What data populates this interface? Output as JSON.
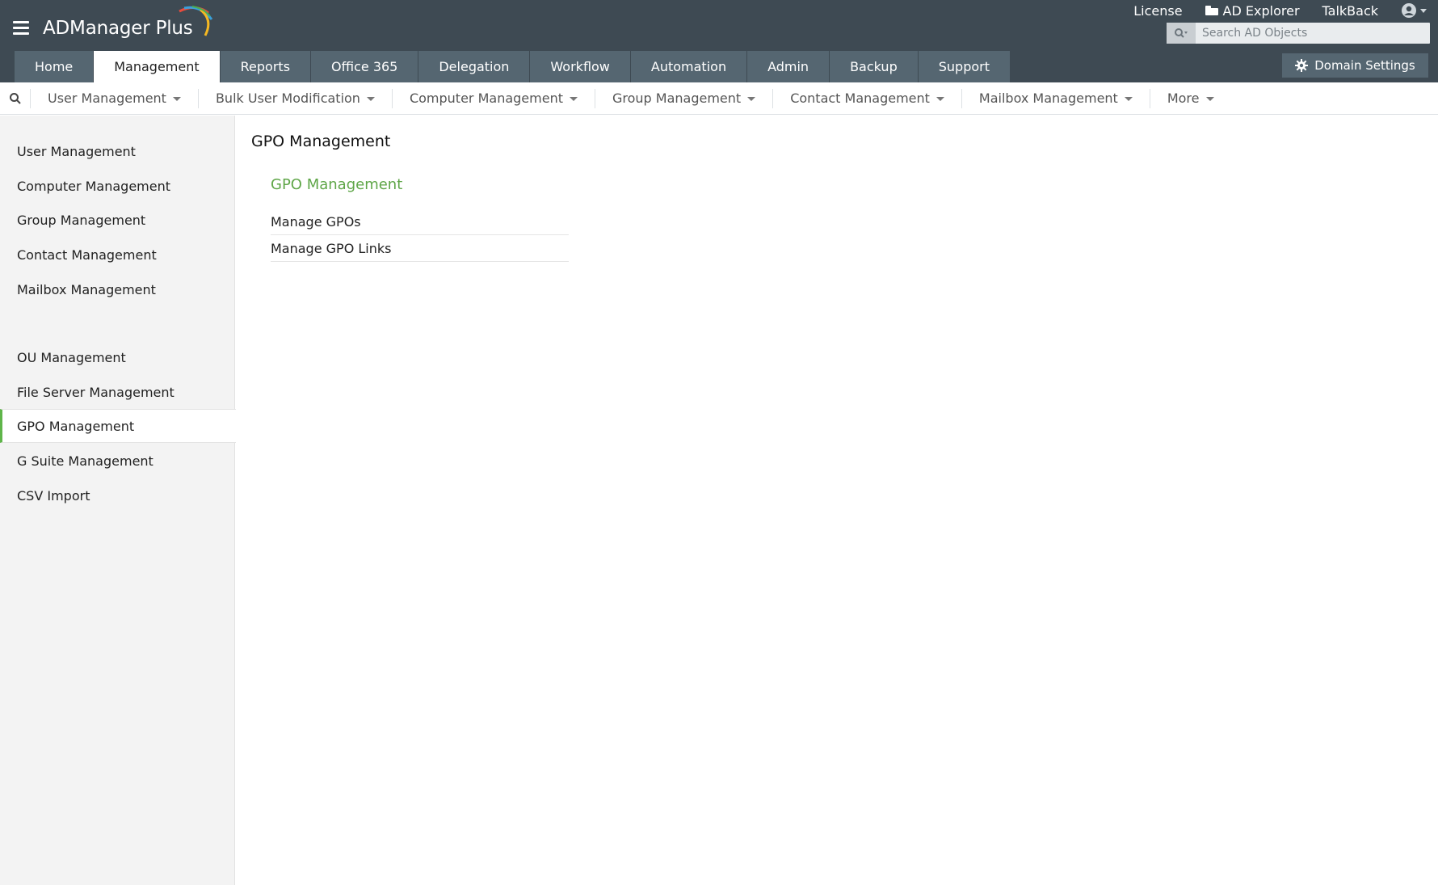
{
  "header": {
    "brand": "ADManager Plus",
    "top_links": {
      "license": "License",
      "ad_explorer": "AD Explorer",
      "talkback": "TalkBack"
    },
    "search": {
      "placeholder": "Search AD Objects"
    },
    "tabs": [
      {
        "label": "Home"
      },
      {
        "label": "Management"
      },
      {
        "label": "Reports"
      },
      {
        "label": "Office 365"
      },
      {
        "label": "Delegation"
      },
      {
        "label": "Workflow"
      },
      {
        "label": "Automation"
      },
      {
        "label": "Admin"
      },
      {
        "label": "Backup"
      },
      {
        "label": "Support"
      }
    ],
    "active_tab": "Management",
    "domain_settings": "Domain Settings"
  },
  "subnav": {
    "items": [
      {
        "label": "User Management"
      },
      {
        "label": "Bulk User Modification"
      },
      {
        "label": "Computer Management"
      },
      {
        "label": "Group Management"
      },
      {
        "label": "Contact Management"
      },
      {
        "label": "Mailbox Management"
      },
      {
        "label": "More"
      }
    ]
  },
  "sidebar": {
    "items": [
      {
        "label": "User Management"
      },
      {
        "label": "Computer Management"
      },
      {
        "label": "Group Management"
      },
      {
        "label": "Contact Management"
      },
      {
        "label": "Mailbox Management"
      },
      {
        "label": "OU Management"
      },
      {
        "label": "File Server Management"
      },
      {
        "label": "GPO Management"
      },
      {
        "label": "G Suite Management"
      },
      {
        "label": "CSV Import"
      }
    ],
    "active_item": "GPO Management"
  },
  "main": {
    "page_title": "GPO Management",
    "section_title": "GPO Management",
    "links": [
      {
        "label": "Manage GPOs"
      },
      {
        "label": "Manage GPO Links"
      }
    ]
  },
  "colors": {
    "header_bg": "#3e4a53",
    "tab_bg": "#556671",
    "accent_green": "#5fb54a"
  }
}
